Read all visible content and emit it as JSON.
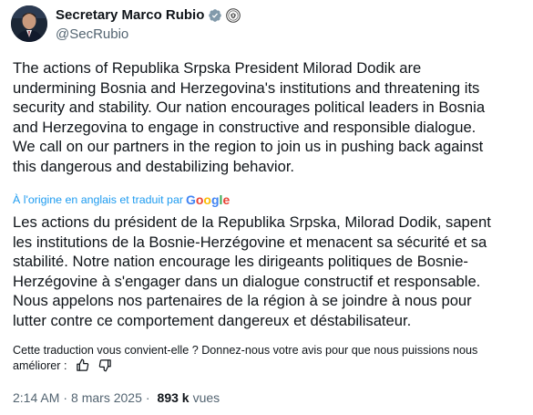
{
  "author": {
    "display_name": "Secretary Marco Rubio",
    "handle": "@SecRubio"
  },
  "tweet": {
    "text": "The actions of Republika Srpska President Milorad Dodik are\nundermining Bosnia and Herzegovina's institutions and threatening its\nsecurity and stability. Our nation encourages political leaders in Bosnia\nand Herzegovina to engage in constructive and responsible dialogue.\nWe call on our partners in the region to join us in pushing back against\nthis dangerous and destabilizing behavior.",
    "translated_label": "À l'origine en anglais et traduit par",
    "translator": "Google",
    "translation": "Les actions du président de la Republika Srpska, Milorad Dodik, sapent\nles institutions de la Bosnie-Herzégovine et menacent sa sécurité et sa\nstabilité. Notre nation encourage les dirigeants politiques de Bosnie-\nHerzégovine à s'engager dans un dialogue constructif et responsable.\nNous appelons nos partenaires de la région à se joindre à nous pour\nlutter contre ce comportement dangereux et déstabilisateur."
  },
  "feedback": {
    "prompt": "Cette traduction vous convient-elle ? Donnez-nous votre avis pour que nous puissions nous améliorer :",
    "icons": [
      "thumbs-up-icon",
      "thumbs-down-icon"
    ]
  },
  "meta": {
    "time": "2:14 AM",
    "separator": "·",
    "date": "8 mars 2025",
    "views_count": "893 k",
    "views_label": "vues"
  },
  "colors": {
    "link": "#1d9bf0",
    "verified": "#829aab",
    "secondary_text": "#536471",
    "google_blue": "#4285f4",
    "google_red": "#ea4335",
    "google_yellow": "#fbbc05",
    "google_green": "#34a853"
  }
}
